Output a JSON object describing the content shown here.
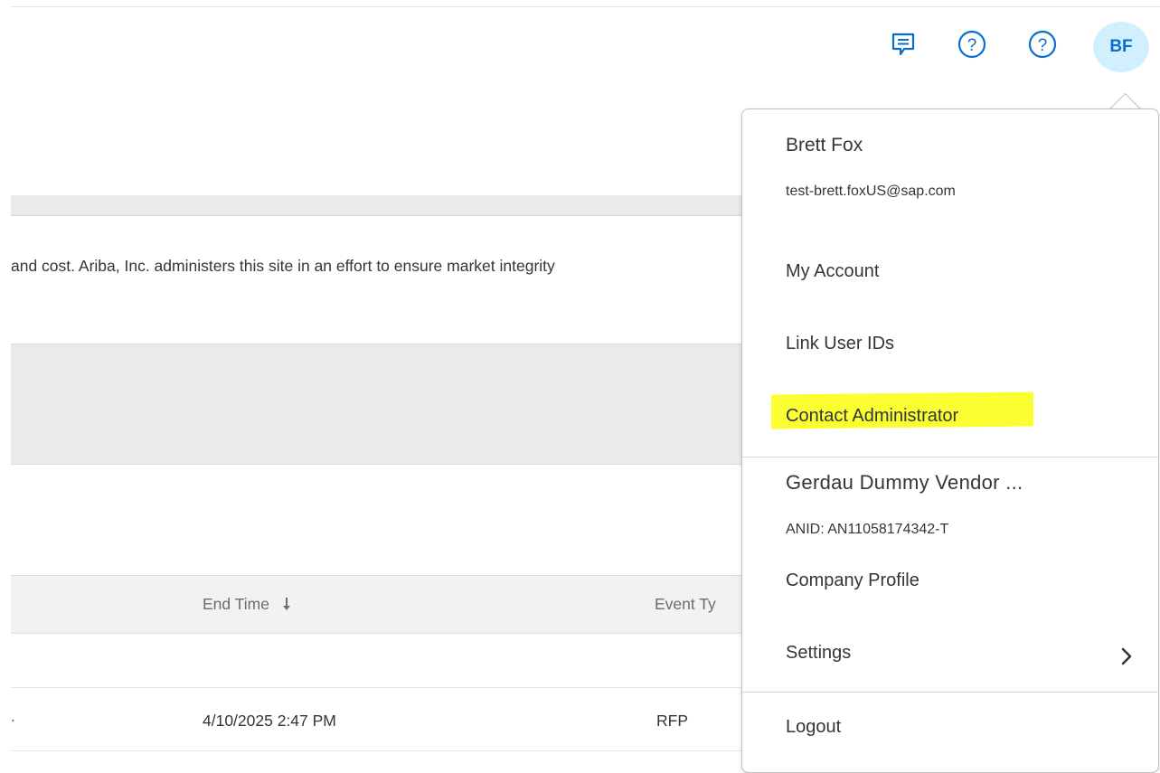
{
  "header": {
    "avatar_initials": "BF",
    "icons": [
      "chat-icon",
      "help-icon",
      "help-icon"
    ],
    "accent_color": "#0a6ed1"
  },
  "page": {
    "notice_text": "and cost. Ariba, Inc. administers this site in an effort to ensure market integrity",
    "table": {
      "columns": [
        "End Time",
        "Event Ty"
      ],
      "rows": [
        {
          "end_time": "4/10/2025 2:47 PM",
          "event_type": "RFP"
        }
      ]
    }
  },
  "user_menu": {
    "name": "Brett Fox",
    "email": "test-brett.foxUS@sap.com",
    "items_account": [
      "My Account",
      "Link User IDs",
      "Contact Administrator"
    ],
    "company_name": "Gerdau Dummy Vendor ...",
    "anid": "ANID: AN11058174342-T",
    "company_profile": "Company Profile",
    "settings": "Settings",
    "logout": "Logout",
    "highlight_color": "#fbff32"
  }
}
